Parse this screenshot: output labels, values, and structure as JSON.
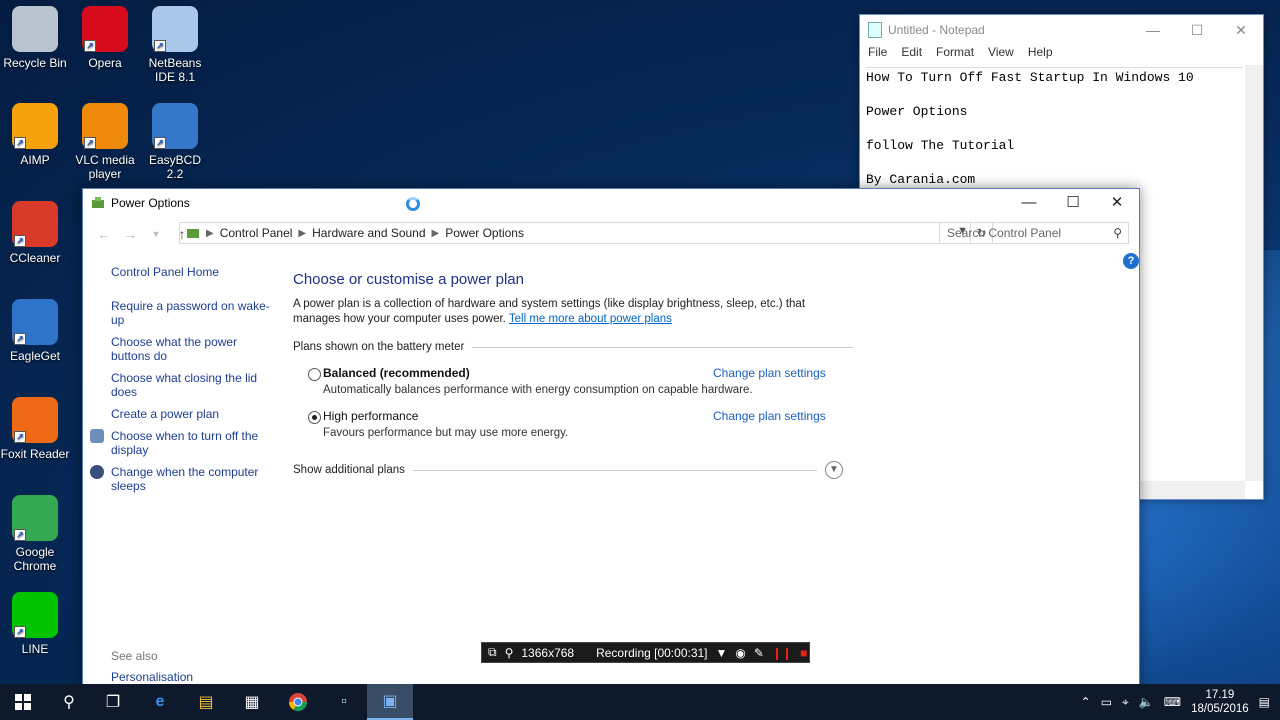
{
  "desktop": {
    "icons": [
      {
        "label": "Recycle Bin",
        "icon": "recycle-bin-icon",
        "color": "#b9c4d0"
      },
      {
        "label": "Opera",
        "icon": "opera-icon",
        "color": "#d60c1c"
      },
      {
        "label": "NetBeans IDE 8.1",
        "icon": "netbeans-icon",
        "color": "#a9c7e8"
      },
      {
        "label": "AIMP",
        "icon": "aimp-icon",
        "color": "#f5a20c"
      },
      {
        "label": "VLC media player",
        "icon": "vlc-icon",
        "color": "#f08a0c"
      },
      {
        "label": "EasyBCD 2.2",
        "icon": "easybcd-icon",
        "color": "#3577c8"
      },
      {
        "label": "CCleaner",
        "icon": "ccleaner-icon",
        "color": "#d83a2a"
      },
      {
        "label": "EagleGet",
        "icon": "eagleget-icon",
        "color": "#2e74c9"
      },
      {
        "label": "Foxit Reader",
        "icon": "foxit-icon",
        "color": "#ef6a17"
      },
      {
        "label": "Google Chrome",
        "icon": "chrome-icon",
        "color": "#34a853"
      },
      {
        "label": "LINE",
        "icon": "line-icon",
        "color": "#00c300"
      }
    ]
  },
  "notepad": {
    "title": "Untitled - Notepad",
    "menu": [
      "File",
      "Edit",
      "Format",
      "View",
      "Help"
    ],
    "lines": [
      "How To Turn Off Fast Startup In Windows 10",
      "",
      "Power Options",
      "",
      "follow The Tutorial",
      "",
      "By Carania.com"
    ]
  },
  "power_window": {
    "title": "Power Options",
    "breadcrumb": [
      "Control Panel",
      "Hardware and Sound",
      "Power Options"
    ],
    "search_placeholder": "Search Control Panel",
    "help_label": "?",
    "sidebar": {
      "home": "Control Panel Home",
      "links": [
        "Require a password on wake-up",
        "Choose what the power buttons do",
        "Choose what closing the lid does",
        "Create a power plan",
        "Choose when to turn off the display",
        "Change when the computer sleeps"
      ],
      "see_also": "See also",
      "personalisation": "Personalisation"
    },
    "main": {
      "heading": "Choose or customise a power plan",
      "description": "A power plan is a collection of hardware and system settings (like display brightness, sleep, etc.) that manages how your computer uses power.",
      "description_link": "Tell me more about power plans",
      "group_label": "Plans shown on the battery meter",
      "plans": [
        {
          "name": "Balanced (recommended)",
          "desc": "Automatically balances performance with energy consumption on capable hardware.",
          "selected": false,
          "bold": true,
          "change": "Change plan settings"
        },
        {
          "name": "High performance",
          "desc": "Favours performance but may use more energy.",
          "selected": true,
          "bold": false,
          "change": "Change plan settings"
        }
      ],
      "show_more": "Show additional plans"
    }
  },
  "recorder": {
    "resolution": "1366x768",
    "status": "Recording [00:00:31]"
  },
  "taskbar": {
    "time": "17.19",
    "date": "18/05/2016"
  }
}
